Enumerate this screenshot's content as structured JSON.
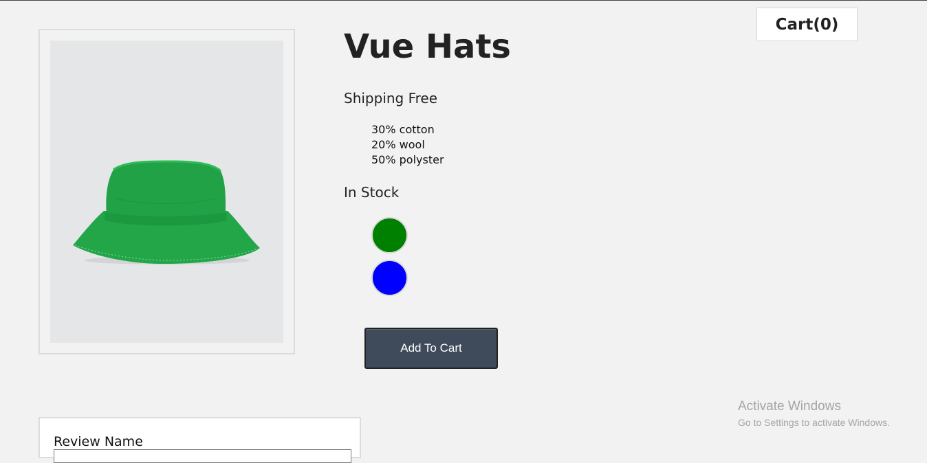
{
  "header": {
    "cart_label": "Cart(0)"
  },
  "product": {
    "title": "Vue Hats",
    "shipping": "Shipping Free",
    "details": [
      "30% cotton",
      "20% wool",
      "50% polyster"
    ],
    "stock_status": "In Stock",
    "variants": [
      {
        "color": "#008000",
        "name": "green"
      },
      {
        "color": "#0000ff",
        "name": "blue"
      }
    ],
    "add_to_cart_label": "Add To Cart",
    "image_icon": "green-bucket-hat-image"
  },
  "review_form": {
    "name_label": "Review Name",
    "name_value": ""
  },
  "watermark": {
    "title": "Activate Windows",
    "subtitle": "Go to Settings to activate Windows."
  },
  "colors": {
    "background": "#f2f2f2",
    "button": "#3f4a5a",
    "hat_green": "#1fa34a"
  }
}
